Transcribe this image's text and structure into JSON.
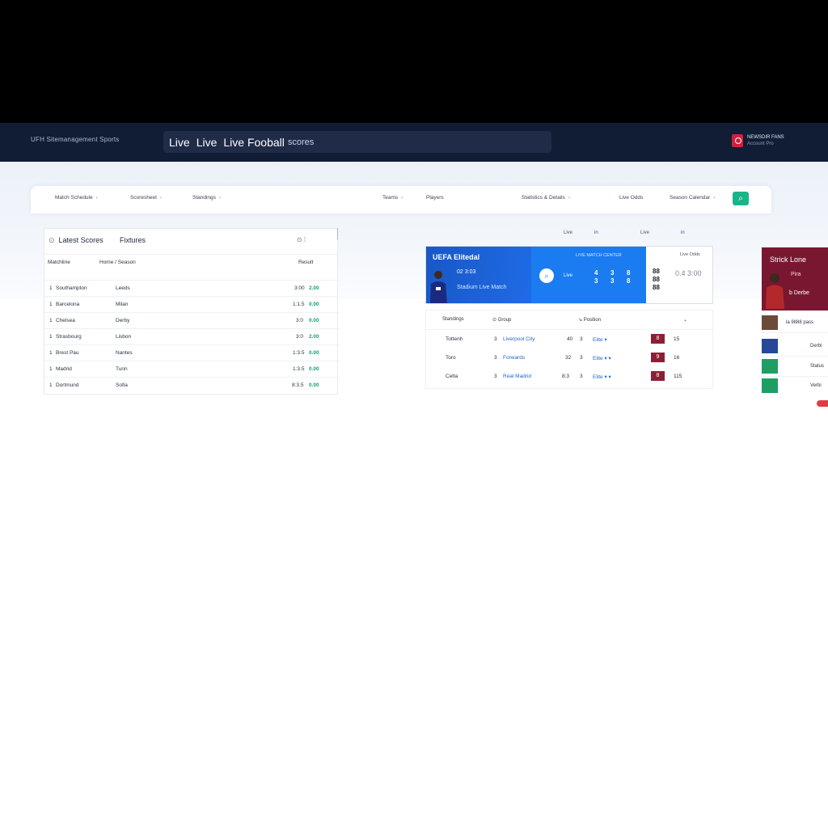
{
  "header": {
    "brand": "UFH Sitemanagement Sports",
    "search_word1": "Live",
    "search_word2": "Live",
    "search_word3": "Live Fooball",
    "search_sub": "scores",
    "user_name": "NEWSDIR FANS",
    "user_role": "Account Pro"
  },
  "nav": {
    "items": [
      "Match Schedule",
      "Scoresheet",
      "Standings",
      "Teams",
      "Players",
      "Statistics & Details",
      "Live Odds",
      "Season Calendar"
    ],
    "action_icon": "search-icon"
  },
  "panel_odds": {
    "title": "Latest Scores",
    "title2": "Fixtures",
    "controls": "⊙ ⁞",
    "headers": [
      "Matchline",
      "Home / Season",
      "Result"
    ],
    "rows": [
      {
        "team": "Southampton",
        "city": "Leeds",
        "score": "3:00",
        "odd": "2.00"
      },
      {
        "team": "Barcelona",
        "city": "Milan",
        "score": "1:1.5",
        "odd": "0.00"
      },
      {
        "team": "Chelsea",
        "city": "Derby",
        "score": "3:0",
        "odd": "0.00"
      },
      {
        "team": "Strasbourg",
        "city": "Lisbon",
        "score": "3:0",
        "odd": "2.00"
      },
      {
        "team": "Brest Pau",
        "city": "Nantes",
        "score": "1:3.5",
        "odd": "0.00"
      },
      {
        "team": "Madrid",
        "city": "Turin",
        "score": "1:3.5",
        "odd": "0.00"
      },
      {
        "team": "Dortmund",
        "city": "Sofia",
        "score": "8:3.5",
        "odd": "0.00"
      }
    ]
  },
  "toolbar2": [
    "Live",
    "in",
    "Live",
    "in"
  ],
  "banner": {
    "title": "UEFA Elitedal",
    "score": "02 3:03",
    "team_line": "Stadium Live Match",
    "match_head": "LIVE MATCH CENTER",
    "mid_label": "Live",
    "col1": "4\n3",
    "col2": "3\n3",
    "col3": "8\n8",
    "right_head": "Live Odds",
    "right_qr": "88\n88\n88",
    "right_score": "0.4 3:00"
  },
  "table2": {
    "headers": [
      "Standings",
      "Group",
      "Position"
    ],
    "rows": [
      {
        "name": "Tottenh",
        "num": "3",
        "link": "Liverpool City",
        "pts": "40",
        "pos": "3",
        "link2": "Elite ▾",
        "flag": "8",
        "gd": "15"
      },
      {
        "name": "Toro",
        "num": "3",
        "link": "Forwards",
        "pts": "32",
        "pos": "3",
        "link2": "Elite ▾ ▾",
        "flag": "9",
        "gd": "16"
      },
      {
        "name": "Celta",
        "num": "3",
        "link": "Real Madrid",
        "pts": "8:3",
        "pos": "3",
        "link2": "Elite ▾ ▾",
        "flag": "8",
        "gd": "115"
      }
    ]
  },
  "side": {
    "title": "Strick Lone",
    "sub": "Pira",
    "sub2": "b Derbe",
    "rows": [
      "la 9888 pass",
      "Derbi",
      "Status",
      "Verbi"
    ]
  },
  "colors": {
    "header_bg": "#111c35",
    "accent_blue": "#1a7cf0",
    "accent_green": "#19b48a",
    "accent_maroon": "#7a1730"
  }
}
